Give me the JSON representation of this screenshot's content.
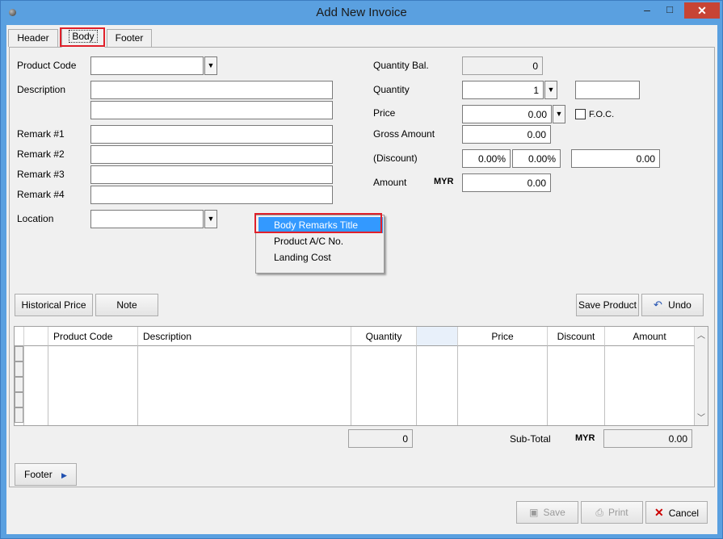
{
  "window": {
    "title": "Add New Invoice",
    "close_glyph": "✕",
    "min_glyph": "–",
    "max_glyph": "□"
  },
  "tabs": [
    {
      "label": "Header",
      "underline": "H"
    },
    {
      "label": "Body",
      "underline": "B"
    },
    {
      "label": "Footer",
      "underline": "F"
    }
  ],
  "left_form": {
    "product_code_label": "Product Code",
    "product_code_value": "",
    "description_label": "Description",
    "description_line1": "",
    "description_line2": "",
    "remark1_label": "Remark #1",
    "remark2_label": "Remark #2",
    "remark3_label": "Remark #3",
    "remark4_label": "Remark #4",
    "remark1_value": "",
    "remark2_value": "",
    "remark3_value": "",
    "remark4_value": "",
    "location_label": "Location",
    "location_value": ""
  },
  "right_form": {
    "qty_bal_label": "Quantity Bal.",
    "qty_bal_value": "0",
    "quantity_label": "Quantity",
    "quantity_value": "1",
    "quantity_extra": "",
    "price_label": "Price",
    "price_value": "0.00",
    "foc_label": "F.O.C.",
    "gross_label": "Gross Amount",
    "gross_value": "0.00",
    "discount_label": "(Discount)",
    "discount_pct1": "0.00%",
    "discount_pct2": "0.00%",
    "discount_value": "0.00",
    "amount_label": "Amount",
    "currency": "MYR",
    "amount_value": "0.00"
  },
  "context_menu": {
    "items": [
      "Body Remarks Title",
      "Product A/C No.",
      "Landing Cost"
    ],
    "selected": "Body Remarks Title"
  },
  "action_buttons": {
    "historical_price": "Historical Price",
    "note": "Note",
    "save_product": "Save Product",
    "undo": "Undo"
  },
  "grid": {
    "columns": [
      "Product Code",
      "Description",
      "Quantity",
      "",
      "Price",
      "Discount",
      "Amount"
    ],
    "rows": []
  },
  "totals": {
    "qty_total": "0",
    "subtotal_label": "Sub-Total",
    "currency": "MYR",
    "subtotal_value": "0.00"
  },
  "footer_button": "Footer",
  "bottom_buttons": {
    "save": "Save",
    "print": "Print",
    "cancel": "Cancel"
  },
  "colors": {
    "highlight": "#e0202a",
    "selection": "#3399ff",
    "titlebar": "#5aa0e0",
    "close": "#c74434"
  }
}
